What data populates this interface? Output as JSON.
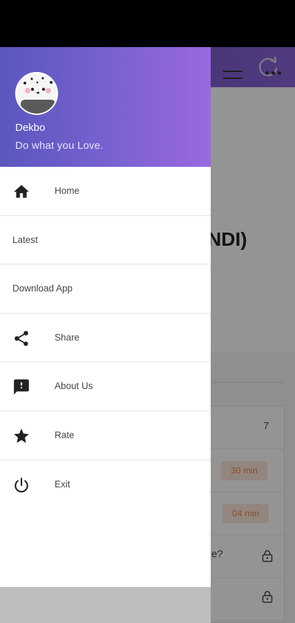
{
  "drawer": {
    "user_name": "Dekbo",
    "tagline": "Do what you Love.",
    "items": [
      {
        "label": "Home",
        "icon": "home-icon"
      },
      {
        "label": "Latest",
        "icon": ""
      },
      {
        "label": "Download App",
        "icon": ""
      },
      {
        "label": "Share",
        "icon": "share-icon"
      },
      {
        "label": "About Us",
        "icon": "feedback-icon"
      },
      {
        "label": "Rate",
        "icon": "star-icon"
      },
      {
        "label": "Exit",
        "icon": "power-icon"
      }
    ]
  },
  "background": {
    "title_fragment": "NDI)",
    "count": "7",
    "pill_1": "30 min",
    "pill_2": "04 min",
    "question_fragment": "e?"
  },
  "colors": {
    "header_gradient_start": "#5a57bd",
    "header_gradient_end": "#9a68e0",
    "pill_bg": "#fde7da",
    "pill_text": "#e98a52"
  }
}
